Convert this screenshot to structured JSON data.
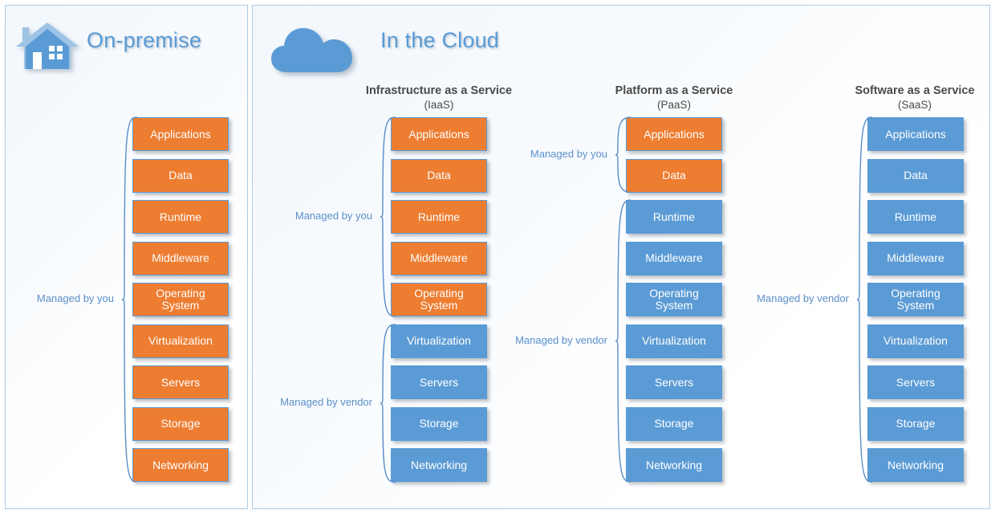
{
  "panels": {
    "onpremise": {
      "title": "On-premise",
      "icon": "house-icon"
    },
    "cloud": {
      "title": "In the Cloud",
      "icon": "cloud-icon"
    }
  },
  "columns": [
    {
      "id": "onprem",
      "header": "",
      "subheader": "",
      "layers": [
        {
          "label": "Applications",
          "color": "orange"
        },
        {
          "label": "Data",
          "color": "orange"
        },
        {
          "label": "Runtime",
          "color": "orange"
        },
        {
          "label": "Middleware",
          "color": "orange"
        },
        {
          "label": "Operating System",
          "color": "orange"
        },
        {
          "label": "Virtualization",
          "color": "orange"
        },
        {
          "label": "Servers",
          "color": "orange"
        },
        {
          "label": "Storage",
          "color": "orange"
        },
        {
          "label": "Networking",
          "color": "orange"
        }
      ],
      "braces": [
        {
          "label": "Managed by you",
          "from": 0,
          "to": 8
        }
      ]
    },
    {
      "id": "iaas",
      "header": "Infrastructure as a Service",
      "subheader": "(IaaS)",
      "layers": [
        {
          "label": "Applications",
          "color": "orange"
        },
        {
          "label": "Data",
          "color": "orange"
        },
        {
          "label": "Runtime",
          "color": "orange"
        },
        {
          "label": "Middleware",
          "color": "orange"
        },
        {
          "label": "Operating System",
          "color": "orange"
        },
        {
          "label": "Virtualization",
          "color": "blue"
        },
        {
          "label": "Servers",
          "color": "blue"
        },
        {
          "label": "Storage",
          "color": "blue"
        },
        {
          "label": "Networking",
          "color": "blue"
        }
      ],
      "braces": [
        {
          "label": "Managed by you",
          "from": 0,
          "to": 4
        },
        {
          "label": "Managed by vendor",
          "from": 5,
          "to": 8
        }
      ]
    },
    {
      "id": "paas",
      "header": "Platform as a Service",
      "subheader": "(PaaS)",
      "layers": [
        {
          "label": "Applications",
          "color": "orange"
        },
        {
          "label": "Data",
          "color": "orange"
        },
        {
          "label": "Runtime",
          "color": "blue"
        },
        {
          "label": "Middleware",
          "color": "blue"
        },
        {
          "label": "Operating System",
          "color": "blue"
        },
        {
          "label": "Virtualization",
          "color": "blue"
        },
        {
          "label": "Servers",
          "color": "blue"
        },
        {
          "label": "Storage",
          "color": "blue"
        },
        {
          "label": "Networking",
          "color": "blue"
        }
      ],
      "braces": [
        {
          "label": "Managed by you",
          "from": 0,
          "to": 1
        },
        {
          "label": "Managed by vendor",
          "from": 2,
          "to": 8
        }
      ]
    },
    {
      "id": "saas",
      "header": "Software as a Service",
      "subheader": "(SaaS)",
      "layers": [
        {
          "label": "Applications",
          "color": "blue"
        },
        {
          "label": "Data",
          "color": "blue"
        },
        {
          "label": "Runtime",
          "color": "blue"
        },
        {
          "label": "Middleware",
          "color": "blue"
        },
        {
          "label": "Operating System",
          "color": "blue"
        },
        {
          "label": "Virtualization",
          "color": "blue"
        },
        {
          "label": "Servers",
          "color": "blue"
        },
        {
          "label": "Storage",
          "color": "blue"
        },
        {
          "label": "Networking",
          "color": "blue"
        }
      ],
      "braces": [
        {
          "label": "Managed by vendor",
          "from": 0,
          "to": 8
        }
      ]
    }
  ],
  "colors": {
    "orange": "#ed7d31",
    "blue": "#5b9bd5",
    "brace": "#5b8fc9",
    "header_text": "#4a4a4a",
    "title": "#5a9bd5",
    "panel_border": "#aec9e6"
  }
}
